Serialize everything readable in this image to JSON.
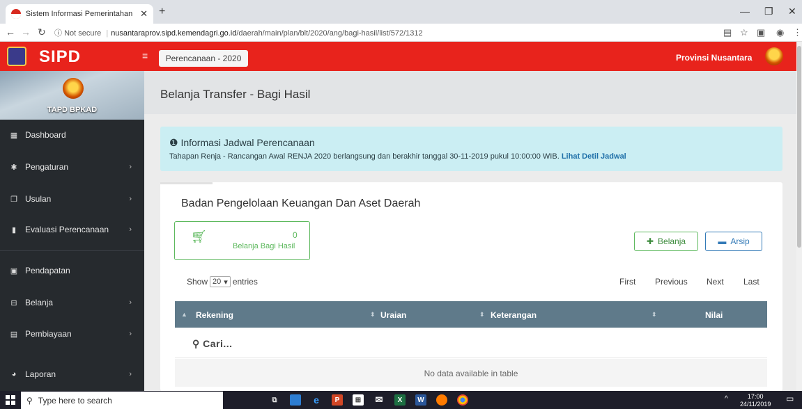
{
  "browser": {
    "tab_title": "Sistem Informasi Pemerintahan D",
    "new_tab": "+",
    "security": "Not secure",
    "url_host": "nusantaraprov.sipd.kemendagri.go.id",
    "url_path": "/daerah/main/plan/blt/2020/ang/bagi-hasil/list/572/1312"
  },
  "header": {
    "brand": "SIPD",
    "plan_label": "Perencanaan - 2020",
    "province": "Provinsi Nusantara"
  },
  "sidebar": {
    "user": "TAPD BPKAD",
    "items": [
      {
        "label": "Dashboard",
        "icon": "dashboard-icon",
        "has_children": false
      },
      {
        "label": "Pengaturan",
        "icon": "cog-icon",
        "has_children": true
      },
      {
        "label": "Usulan",
        "icon": "comments-icon",
        "has_children": true
      },
      {
        "label": "Evaluasi Perencanaan",
        "icon": "bookmark-icon",
        "has_children": true
      },
      {
        "label": "Pendapatan",
        "icon": "money-icon",
        "has_children": false
      },
      {
        "label": "Belanja",
        "icon": "cart-icon",
        "has_children": true
      },
      {
        "label": "Pembiayaan",
        "icon": "calculator-icon",
        "has_children": true
      },
      {
        "label": "Laporan",
        "icon": "pie-chart-icon",
        "has_children": true
      }
    ]
  },
  "main": {
    "page_title": "Belanja Transfer - Bagi Hasil",
    "info": {
      "heading": "Informasi Jadwal Perencanaan",
      "text": "Tahapan Renja - Rancangan Awal RENJA 2020 berlangsung dan berakhir tanggal 30-11-2019 pukul 10:00:00 WIB.",
      "link": "Lihat Detil Jadwal"
    },
    "card_title": "Badan Pengelolaan Keuangan Dan Aset Daerah",
    "stat": {
      "value": "0",
      "label": "Belanja Bagi Hasil"
    },
    "buttons": {
      "add": "Belanja",
      "archive": "Arsip"
    },
    "table": {
      "show_label": "Show",
      "page_size": "20",
      "entries_label": "entries",
      "pagination": [
        "First",
        "Previous",
        "Next",
        "Last"
      ],
      "columns": [
        "Rekening",
        "Uraian",
        "Keterangan",
        "Nilai"
      ],
      "search_placeholder": "Cari...",
      "empty_text": "No data available in table"
    }
  },
  "taskbar": {
    "search": "Type here to search",
    "time": "17:00",
    "date": "24/11/2019"
  },
  "colors": {
    "header_red": "#e8231c",
    "sidebar": "#262a2e",
    "table_header": "#5f7a8a",
    "success": "#5cb85c",
    "primary": "#337ab7",
    "info_bg": "#cbeef3"
  }
}
